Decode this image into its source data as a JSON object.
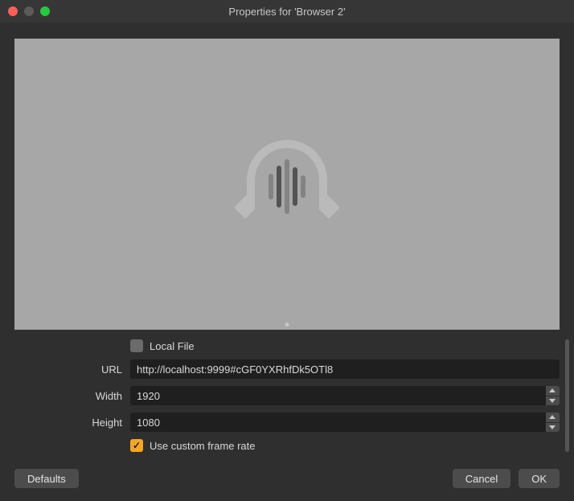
{
  "window": {
    "title": "Properties for 'Browser 2'"
  },
  "form": {
    "local_file": {
      "label": "Local File",
      "checked": false
    },
    "url": {
      "label": "URL",
      "value": "http://localhost:9999#cGF0YXRhfDk5OTl8"
    },
    "width": {
      "label": "Width",
      "value": "1920"
    },
    "height": {
      "label": "Height",
      "value": "1080"
    },
    "custom_frame_rate": {
      "label": "Use custom frame rate",
      "checked": true
    }
  },
  "buttons": {
    "defaults": "Defaults",
    "cancel": "Cancel",
    "ok": "OK"
  }
}
